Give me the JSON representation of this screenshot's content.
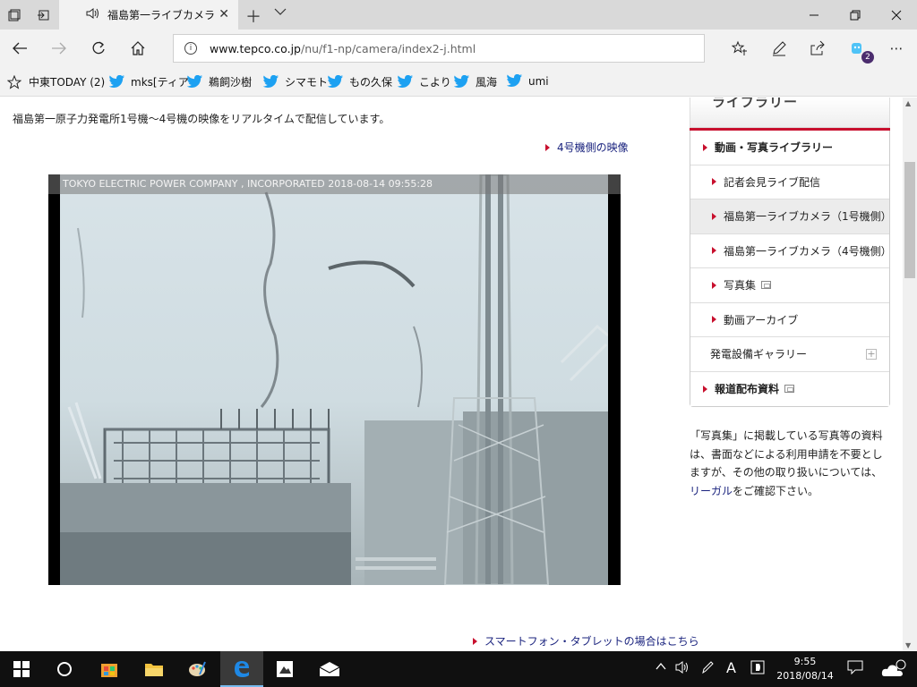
{
  "browser": {
    "tab_title": "福島第一ライブカメラ",
    "url_domain": "www.tepco.co.jp",
    "url_path": "/nu/f1-np/camera/index2-j.html",
    "notification_count": "2"
  },
  "favorites": [
    {
      "label": "中東TODAY (2)",
      "icon": "star-icon"
    },
    {
      "label": "mks[ティア",
      "icon": "twitter-icon"
    },
    {
      "label": "鵜飼沙樹",
      "icon": "twitter-icon"
    },
    {
      "label": "シマモト",
      "icon": "twitter-icon"
    },
    {
      "label": "もの久保",
      "icon": "twitter-icon"
    },
    {
      "label": "こより",
      "icon": "twitter-icon"
    },
    {
      "label": "風海",
      "icon": "twitter-icon"
    },
    {
      "label": "umi",
      "icon": "twitter-icon"
    }
  ],
  "page": {
    "intro": "福島第一原子力発電所1号機～4号機の映像をリアルタイムで配信しています。",
    "unit4_link": "4号機側の映像",
    "camera_stamp": "TOKYO ELECTRIC POWER COMPANY , INCORPORATED 2018-08-14 09:55:28",
    "smartphone_link": "スマートフォン・タブレットの場合はこちら"
  },
  "sidebar": {
    "header": "ライブラリー",
    "items": [
      {
        "label": "動画・写真ライブラリー",
        "level": 0
      },
      {
        "label": "記者会見ライブ配信",
        "level": 1
      },
      {
        "label": "福島第一ライブカメラ（1号機側）",
        "level": 1,
        "selected": true
      },
      {
        "label": "福島第一ライブカメラ（4号機側）",
        "level": 1
      },
      {
        "label": "写真集",
        "level": 1
      },
      {
        "label": "動画アーカイブ",
        "level": 1
      },
      {
        "label": "発電設備ギャラリー",
        "level": "plain"
      },
      {
        "label": "報道配布資料",
        "level": 0
      }
    ],
    "note_part1": "「写真集」に掲載している写真等の資料は、書面などによる利用申請を不要としますが、その他の取り扱いについては、",
    "note_link": "リーガル",
    "note_part2": "をご確認下さい。"
  },
  "taskbar": {
    "time": "9:55",
    "date": "2018/08/14",
    "ime": "A"
  },
  "colors": {
    "accent_red": "#c8102e",
    "link_blue": "#1a237e",
    "twitter_blue": "#1da1f2",
    "edge_blue": "#0078d7"
  }
}
